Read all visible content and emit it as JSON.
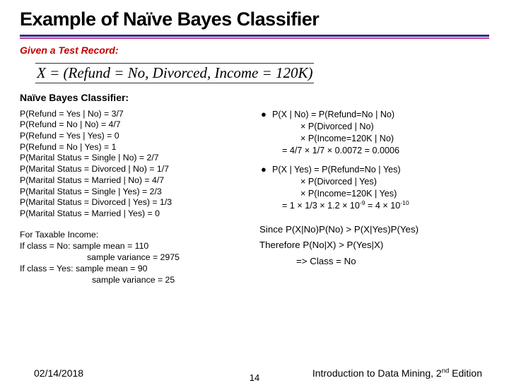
{
  "title": "Example of Naïve Bayes Classifier",
  "given_label": "Given a Test Record:",
  "record": "X = (Refund = No, Divorced, Income = 120K)",
  "classifier_label": "Naïve  Bayes Classifier:",
  "probs": {
    "l1": "P(Refund = Yes | No) = 3/7",
    "l2": "P(Refund = No | No) = 4/7",
    "l3": "P(Refund = Yes | Yes) = 0",
    "l4": "P(Refund = No | Yes) = 1",
    "l5": "P(Marital Status = Single | No) = 2/7",
    "l6": "P(Marital Status = Divorced | No) = 1/7",
    "l7": "P(Marital Status = Married | No) = 4/7",
    "l8": "P(Marital Status = Single | Yes) = 2/3",
    "l9": "P(Marital Status = Divorced | Yes) = 1/3",
    "l10": "P(Marital Status = Married | Yes) = 0"
  },
  "tax": {
    "h": "For Taxable Income:",
    "n1": "If class = No: sample mean = 110",
    "n2": "sample variance = 2975",
    "y1": "If class = Yes: sample mean = 90",
    "y2": "sample variance = 25"
  },
  "bullet1": {
    "main": "P(X | No) = P(Refund=No | No)",
    "sub1": "× P(Divorced | No)",
    "sub2": "× P(Income=120K | No)",
    "res": "= 4/7 × 1/7 × 0.0072 = 0.0006"
  },
  "bullet2": {
    "main": "P(X | Yes) = P(Refund=No | Yes)",
    "sub1": "× P(Divorced | Yes)",
    "sub2": "× P(Income=120K | Yes)",
    "resA": "= 1 × 1/3 × 1.2 × 10",
    "supA": "-9",
    "resB": " = 4 × 10",
    "supB": "-10"
  },
  "since": {
    "l1": "Since P(X|No)P(No) > P(X|Yes)P(Yes)",
    "l2": "Therefore P(No|X) > P(Yes|X)",
    "l3": "=> Class = No"
  },
  "footer": {
    "date": "02/14/2018",
    "bookA": "Introduction to Data Mining, 2",
    "bookSup": "nd",
    "bookB": " Edition",
    "page": "14"
  }
}
